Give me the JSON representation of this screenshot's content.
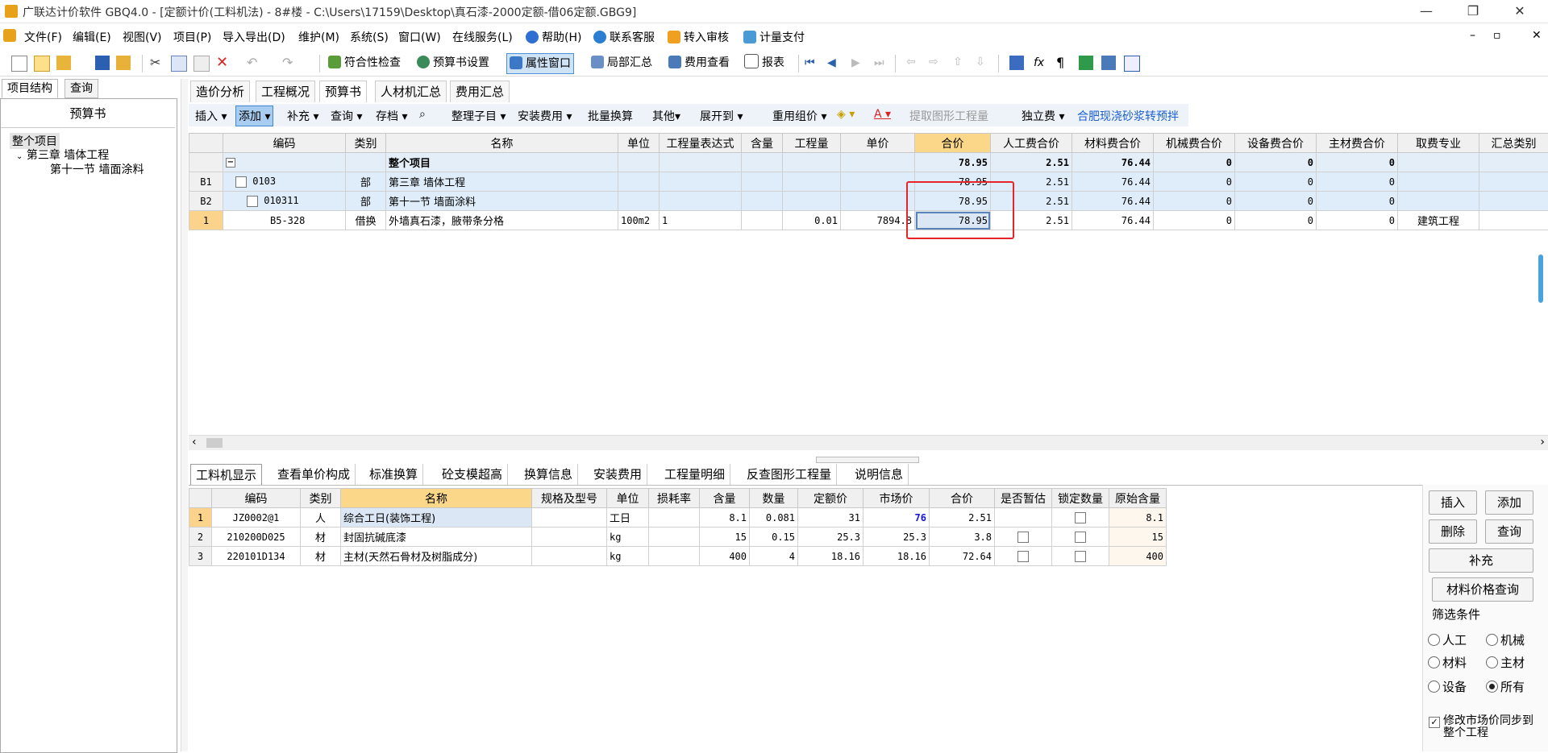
{
  "window": {
    "title": "广联达计价软件 GBQ4.0 - [定额计价(工料机法) - 8#楼 - C:\\Users\\17159\\Desktop\\真石漆-2000定额-借06定额.GBG9]",
    "min": "—",
    "restore": "❐",
    "close": "✕"
  },
  "mdi": {
    "min": "–",
    "restore": "▫",
    "close": "✕"
  },
  "menu": [
    "文件(F)",
    "编辑(E)",
    "视图(V)",
    "项目(P)",
    "导入导出(D)",
    "维护(M)",
    "系统(S)",
    "窗口(W)",
    "在线服务(L)",
    "帮助(H)",
    "联系客服",
    "转入审核",
    "计量支付"
  ],
  "toolbar": {
    "check": "符合性检查",
    "settings": "预算书设置",
    "property": "属性窗口",
    "partial": "局部汇总",
    "fees": "费用查看",
    "report": "报表"
  },
  "left": {
    "tabs": [
      "项目结构",
      "查询"
    ],
    "header": "预算书",
    "tree": [
      "整个项目",
      "第三章 墙体工程",
      "第十一节 墙面涂料"
    ]
  },
  "main_tabs": [
    "造价分析",
    "工程概况",
    "预算书",
    "人材机汇总",
    "费用汇总"
  ],
  "subtoolbar": [
    "插入",
    "添加",
    "补充",
    "查询",
    "存档",
    "整理子目",
    "安装费用",
    "批量换算",
    "其他",
    "展开到",
    "重用组价",
    "提取图形工程量",
    "独立费",
    "合肥现浇砂浆转预拌"
  ],
  "upper": {
    "columns": [
      "编码",
      "类别",
      "名称",
      "单位",
      "工程量表达式",
      "含量",
      "工程量",
      "单价",
      "合价",
      "人工费合价",
      "材料费合价",
      "机械费合价",
      "设备费合价",
      "主材费合价",
      "取费专业",
      "汇总类别"
    ],
    "rows": [
      {
        "rowno": "",
        "code": "",
        "type": "",
        "name": "整个项目",
        "unit": "",
        "expr": "",
        "content": "",
        "qty": "",
        "price": "",
        "total": "78.95",
        "labor": "2.51",
        "material": "76.44",
        "machine": "0",
        "equip": "0",
        "main": "0",
        "fee": ""
      },
      {
        "rowno": "B1",
        "code": "0103",
        "type": "部",
        "name": "第三章 墙体工程",
        "unit": "",
        "expr": "",
        "content": "",
        "qty": "",
        "price": "",
        "total": "78.95",
        "labor": "2.51",
        "material": "76.44",
        "machine": "0",
        "equip": "0",
        "main": "0",
        "fee": ""
      },
      {
        "rowno": "B2",
        "code": "010311",
        "type": "部",
        "name": "第十一节 墙面涂料",
        "unit": "",
        "expr": "",
        "content": "",
        "qty": "",
        "price": "",
        "total": "78.95",
        "labor": "2.51",
        "material": "76.44",
        "machine": "0",
        "equip": "0",
        "main": "0",
        "fee": ""
      },
      {
        "rowno": "1",
        "code": "B5-328",
        "type": "借换",
        "name": "外墙真石漆，腋带条分格",
        "unit": "100m2",
        "expr": "1",
        "content": "",
        "qty": "0.01",
        "price": "7894.8",
        "total": "78.95",
        "labor": "2.51",
        "material": "76.44",
        "machine": "0",
        "equip": "0",
        "main": "0",
        "fee": "建筑工程"
      }
    ]
  },
  "bottom_tabs": [
    "工料机显示",
    "查看单价构成",
    "标准换算",
    "砼支模超高",
    "换算信息",
    "安装费用",
    "工程量明细",
    "反查图形工程量",
    "说明信息"
  ],
  "lower": {
    "columns": [
      "编码",
      "类别",
      "名称",
      "规格及型号",
      "单位",
      "损耗率",
      "含量",
      "数量",
      "定额价",
      "市场价",
      "合价",
      "是否暂估",
      "锁定数量",
      "原始含量"
    ],
    "rows": [
      {
        "no": "1",
        "code": "JZ0002@1",
        "type": "人",
        "name": "综合工日(装饰工程)",
        "spec": "",
        "unit": "工日",
        "loss": "",
        "content": "8.1",
        "qty": "0.081",
        "quota": "31",
        "market": "76",
        "total": "2.51",
        "orig": "8.1"
      },
      {
        "no": "2",
        "code": "210200D025",
        "type": "材",
        "name": "封固抗碱底漆",
        "spec": "",
        "unit": "kg",
        "loss": "",
        "content": "15",
        "qty": "0.15",
        "quota": "25.3",
        "market": "25.3",
        "total": "3.8",
        "orig": "15"
      },
      {
        "no": "3",
        "code": "220101D134",
        "type": "材",
        "name": "主材(天然石骨材及树脂成分)",
        "spec": "",
        "unit": "kg",
        "loss": "",
        "content": "400",
        "qty": "4",
        "quota": "18.16",
        "market": "18.16",
        "total": "72.64",
        "orig": "400"
      }
    ]
  },
  "right": {
    "insert": "插入",
    "add": "添加",
    "delete": "删除",
    "query": "查询",
    "supplement": "补充",
    "price_query": "材料价格查询",
    "filter_title": "筛选条件",
    "filters": [
      "人工",
      "机械",
      "材料",
      "主材",
      "设备",
      "所有"
    ],
    "sync_label": "修改市场价同步到整个工程"
  },
  "colors": {
    "accent": "#3f86d4",
    "highlight": "#fad789",
    "redbox": "#e8242b",
    "market_blue": "#1414e0"
  }
}
